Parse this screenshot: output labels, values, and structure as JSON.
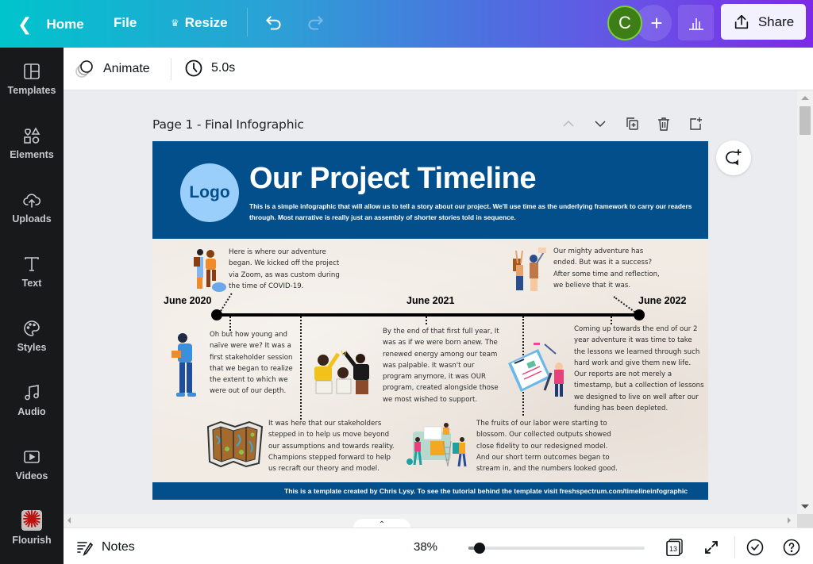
{
  "topbar": {
    "home_label": "Home",
    "file_label": "File",
    "resize_label": "Resize",
    "undo_icon": "undo-icon",
    "redo_icon": "redo-icon",
    "avatar_initial": "C",
    "add_collaborator_label": "+",
    "share_label": "Share",
    "gradient_start": "#00c4cc",
    "gradient_end": "#7d2ae8"
  },
  "sidebar": {
    "items": [
      {
        "label": "Templates",
        "icon": "templates-icon"
      },
      {
        "label": "Elements",
        "icon": "elements-icon"
      },
      {
        "label": "Uploads",
        "icon": "upload-cloud-icon"
      },
      {
        "label": "Text",
        "icon": "text-icon"
      },
      {
        "label": "Styles",
        "icon": "palette-icon"
      },
      {
        "label": "Audio",
        "icon": "music-note-icon"
      },
      {
        "label": "Videos",
        "icon": "video-icon"
      },
      {
        "label": "Flourish",
        "icon": "flourish-app-icon"
      }
    ]
  },
  "toolbar": {
    "animate_label": "Animate",
    "duration_label": "5.0s"
  },
  "page": {
    "title": "Page 1 - Final Infographic"
  },
  "infographic": {
    "logo_text": "Logo",
    "title": "Our Project Timeline",
    "subtitle": "This is a simple infographic that will allow us to tell a story about our project.  We'll use time as the underlying framework to carry our readers through.  Most narrative is really just an assembly of shorter stories told in sequence.",
    "header_color": "#034f8c",
    "logo_color": "#9bcffb",
    "dates": [
      "June 2020",
      "June 2021",
      "June 2022"
    ],
    "stories": [
      "Here is  where our adventure began.  We kicked off the project via Zoom, as was custom during the time of COVID-19.",
      "Our mighty adventure has ended.  But was it a success? After some time and reflection, we believe that it was.",
      "Oh  but how young and naïve were we?  It was a first stakeholder session that we began to realize the extent to which we were out of our depth.",
      "By the end of that first full year, It was as if we were born anew.  The renewed energy among our team was palpable.  It wasn't our program anymore, it was OUR program, created alongside those we most wished to support.",
      "Coming up towards the end of our 2 year adventure it was time to take the lessons we learned through such hard work and give them new life. Our reports are not merely a timestamp, but a collection of lessons we designed to live on well after our funding has been depleted.",
      "It was here that our stakeholders stepped in to help us move beyond our assumptions and towards reality. Champions stepped forward to help us recraft our theory and model.",
      "The fruits of our labor were starting to blossom.  Our collected outputs showed close fidelity to our redesigned model. And our short term outcomes began to stream in, and the numbers looked good."
    ],
    "footer": "This is a template created by Chris Lysy.  To see the tutorial behind the template visit freshspectrum.com/timelineinfographic"
  },
  "bottombar": {
    "notes_label": "Notes",
    "zoom_label": "38%",
    "zoom_value_percent": 38,
    "page_count": "13"
  }
}
